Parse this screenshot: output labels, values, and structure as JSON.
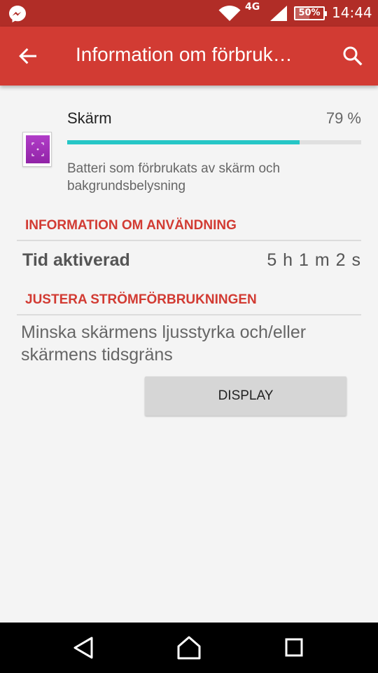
{
  "status_bar": {
    "network": "4G",
    "battery": "50%",
    "battery_level": 0.5,
    "time": "14:44"
  },
  "app_bar": {
    "title": "Information om förbruk…"
  },
  "usage_item": {
    "title": "Skärm",
    "percent": "79 %",
    "percent_value": 79,
    "description": "Batteri som förbrukats av skärm och bakgrundsbelysning"
  },
  "usage_section": {
    "header": "INFORMATION OM ANVÄNDNING",
    "rows": [
      {
        "label": "Tid aktiverad",
        "value": "5 h 1 m 2 s"
      }
    ]
  },
  "adjust_section": {
    "header": "JUSTERA STRÖMFÖRBRUKNINGEN",
    "tip": "Minska skärmens ljusstyrka och/eller skärmens tidsgräns",
    "button_label": "DISPLAY"
  },
  "colors": {
    "status_bar": "#b12d27",
    "app_bar": "#d23b33",
    "accent": "#d23b33",
    "progress": "#26c6c6"
  },
  "icons": {
    "status": [
      "messenger-icon",
      "wifi-icon",
      "signal-icon",
      "battery-icon"
    ],
    "app_bar": [
      "back-arrow-icon",
      "search-icon"
    ],
    "item": "screen-app-icon",
    "nav": [
      "back-nav-icon",
      "home-nav-icon",
      "recents-nav-icon"
    ]
  }
}
